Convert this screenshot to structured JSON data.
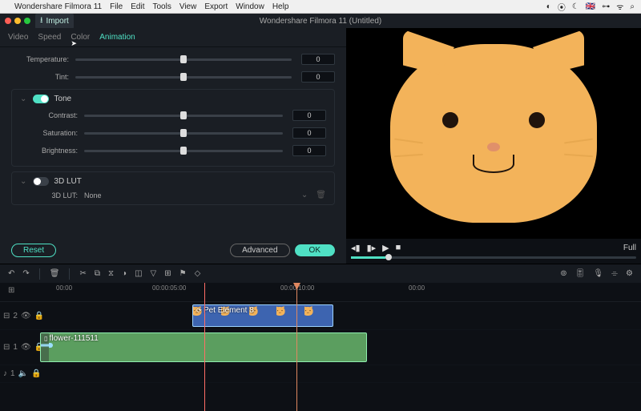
{
  "mac_menu": {
    "apple": "",
    "app": "Wondershare Filmora 11",
    "items": [
      "File",
      "Edit",
      "Tools",
      "View",
      "Export",
      "Window",
      "Help"
    ],
    "lang": "🇬🇧"
  },
  "titlebar": {
    "import": "Import",
    "title": "Wondershare Filmora 11 (Untitled)"
  },
  "prop_tabs": {
    "video": "Video",
    "speed": "Speed",
    "color": "Color",
    "animation": "Animation"
  },
  "color": {
    "temperature_label": "Temperature:",
    "temperature_value": "0",
    "tint_label": "Tint:",
    "tint_value": "0",
    "tone_label": "Tone",
    "contrast_label": "Contrast:",
    "contrast_value": "0",
    "saturation_label": "Saturation:",
    "saturation_value": "0",
    "brightness_label": "Brightness:",
    "brightness_value": "0",
    "lut_section": "3D LUT",
    "lut_label": "3D LUT:",
    "lut_value": "None"
  },
  "buttons": {
    "reset": "Reset",
    "advanced": "Advanced",
    "ok": "OK"
  },
  "preview": {
    "quality": "Full"
  },
  "ruler": {
    "t0": "00:00",
    "t1": "00:00:05:00",
    "t2": "00:00:10:00",
    "t3": "00:00"
  },
  "timeline": {
    "track2": {
      "id": "2"
    },
    "track1": {
      "id": "1"
    },
    "audio_track": {
      "id": "1"
    },
    "clip_pet": "Pet Element 8",
    "clip_flower": "flower-111511"
  }
}
